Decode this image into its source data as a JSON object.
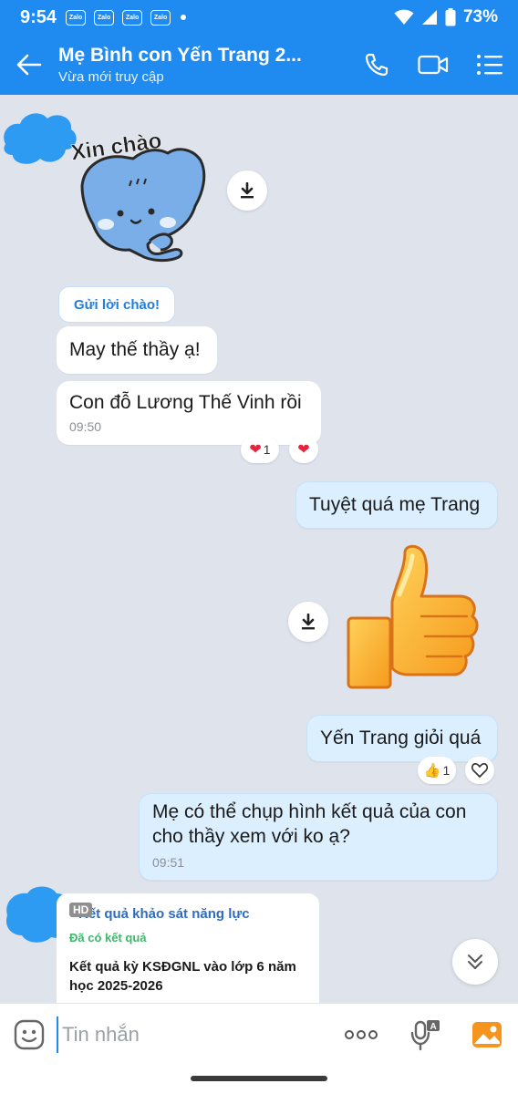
{
  "status_bar": {
    "time": "9:54",
    "badges": [
      "Zalo",
      "Zalo",
      "Zalo",
      "Zalo"
    ],
    "battery": "73%"
  },
  "header": {
    "title": "Mẹ Bình con Yến Trang 2...",
    "subtitle": "Vừa mới truy cập",
    "icons": [
      "back-arrow-icon",
      "phone-icon",
      "video-call-icon",
      "menu-icon"
    ]
  },
  "messages": {
    "sticker_greeting_text": "Xin chào",
    "greet_chip": "Gửi lời chào!",
    "m1": "May thế thầy ạ!",
    "m2": "Con đỗ Lương Thế Vinh rồi",
    "m2_time": "09:50",
    "m2_reaction_count": "1",
    "m3": "Tuyệt quá mẹ Trang",
    "m4": "Yến Trang giỏi quá",
    "m4_reaction_count": "1",
    "m5": "Mẹ có thể chụp hình kết quả của con cho thầy xem với ko ạ?",
    "m5_time": "09:51"
  },
  "card": {
    "badge": "HD",
    "title": "Kết quả khảo sát năng lực",
    "status": "Đã có kết quả",
    "body": "Kết quả kỳ KSĐGNL vào lớp 6 năm học 2025-2026"
  },
  "input_bar": {
    "placeholder": "Tin nhắn",
    "icons": [
      "emoji-icon",
      "more-icon",
      "voice-text-icon",
      "image-icon"
    ]
  },
  "colors": {
    "brand": "#1f8af0",
    "chat_bg": "#dfe3ec",
    "own_bubble": "#dcefff"
  }
}
